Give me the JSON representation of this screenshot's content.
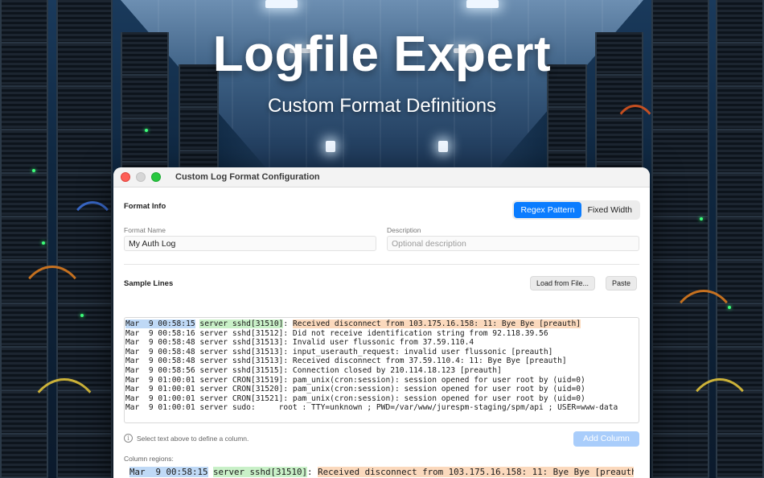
{
  "hero": {
    "title": "Logfile Expert",
    "subtitle": "Custom Format Definitions"
  },
  "window": {
    "title": "Custom Log Format Configuration",
    "traffic_lights": [
      "close",
      "minimize",
      "zoom"
    ]
  },
  "format_info": {
    "section_label": "Format Info",
    "mode_options": [
      "Regex Pattern",
      "Fixed Width"
    ],
    "selected_mode": "Regex Pattern",
    "name_label": "Format Name",
    "name_value": "My Auth Log",
    "description_label": "Description",
    "description_placeholder": "Optional description"
  },
  "sample_lines": {
    "section_label": "Sample Lines",
    "load_button": "Load from File...",
    "paste_button": "Paste",
    "first_line_parts": {
      "timestamp": "Mar  9 00:58:15",
      "source": "server sshd[31510]",
      "separator": ": ",
      "message": "Received disconnect from 103.175.16.158: 11: Bye Bye [preauth]"
    },
    "lines": [
      "Mar  9 00:58:16 server sshd[31512]: Did not receive identification string from 92.118.39.56",
      "Mar  9 00:58:48 server sshd[31513]: Invalid user flussonic from 37.59.110.4",
      "Mar  9 00:58:48 server sshd[31513]: input_userauth_request: invalid user flussonic [preauth]",
      "Mar  9 00:58:48 server sshd[31513]: Received disconnect from 37.59.110.4: 11: Bye Bye [preauth]",
      "Mar  9 00:58:56 server sshd[31515]: Connection closed by 210.114.18.123 [preauth]",
      "Mar  9 01:00:01 server CRON[31519]: pam_unix(cron:session): session opened for user root by (uid=0)",
      "Mar  9 01:00:01 server CRON[31520]: pam_unix(cron:session): session opened for user root by (uid=0)",
      "Mar  9 01:00:01 server CRON[31521]: pam_unix(cron:session): session opened for user root by (uid=0)",
      "Mar  9 01:00:01 server sudo:     root : TTY=unknown ; PWD=/var/www/jurespm-staging/spm/api ; USER=www-data"
    ]
  },
  "columns": {
    "hint": "Select text above to define a column.",
    "add_button": "Add Column",
    "regions_label": "Column regions:",
    "preview": {
      "timestamp": "Mar  9 00:58:15",
      "source": "server sshd[31510]",
      "separator": ": ",
      "message": "Received disconnect from 103.175.16.158: 11: Bye Bye [preauth]"
    }
  },
  "colors": {
    "accent": "#0a7cff",
    "highlight_timestamp": "#bfd9f6",
    "highlight_source": "#c9f0c8",
    "highlight_message": "#fbd9bd"
  }
}
